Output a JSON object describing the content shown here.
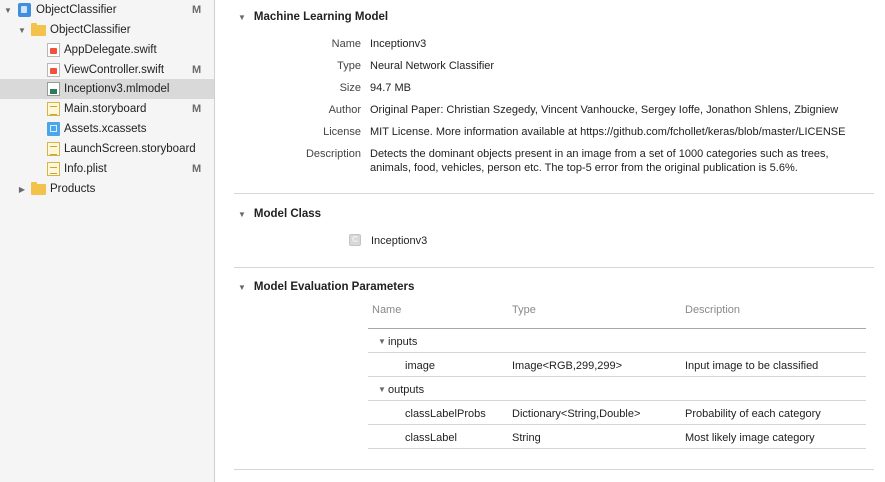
{
  "navigator": {
    "items": [
      {
        "label": "ObjectClassifier",
        "badge": "M",
        "icon": "project-icon",
        "disclosure": "open"
      },
      {
        "label": "ObjectClassifier",
        "badge": "",
        "icon": "folder-icon",
        "disclosure": "open"
      },
      {
        "label": "AppDelegate.swift",
        "badge": "",
        "icon": "swift-file-icon"
      },
      {
        "label": "ViewController.swift",
        "badge": "M",
        "icon": "swift-file-icon"
      },
      {
        "label": "Inceptionv3.mlmodel",
        "badge": "",
        "icon": "mlmodel-file-icon",
        "selected": true
      },
      {
        "label": "Main.storyboard",
        "badge": "M",
        "icon": "storyboard-file-icon"
      },
      {
        "label": "Assets.xcassets",
        "badge": "",
        "icon": "asset-catalog-icon"
      },
      {
        "label": "LaunchScreen.storyboard",
        "badge": "",
        "icon": "storyboard-file-icon"
      },
      {
        "label": "Info.plist",
        "badge": "M",
        "icon": "plist-file-icon"
      },
      {
        "label": "Products",
        "badge": "",
        "icon": "folder-icon",
        "disclosure": "closed"
      }
    ]
  },
  "model": {
    "section_title": "Machine Learning Model",
    "properties": [
      {
        "label": "Name",
        "value": "Inceptionv3"
      },
      {
        "label": "Type",
        "value": "Neural Network Classifier"
      },
      {
        "label": "Size",
        "value": "94.7 MB"
      },
      {
        "label": "Author",
        "value": "Original Paper: Christian Szegedy, Vincent Vanhoucke, Sergey Ioffe, Jonathon Shlens, Zbigniew"
      },
      {
        "label": "License",
        "value": "MIT License. More information available at https://github.com/fchollet/keras/blob/master/LICENSE"
      },
      {
        "label": "Description",
        "value": "Detects the dominant objects present in an image from a set of 1000 categories such as trees,",
        "value_line2": "animals, food, vehicles, person etc. The top-5 error from the original publication is 5.6%."
      }
    ]
  },
  "model_class": {
    "section_title": "Model Class",
    "class_name": "Inceptionv3",
    "icon_glyph": "C"
  },
  "evaluation": {
    "section_title": "Model Evaluation Parameters",
    "columns": [
      "Name",
      "Type",
      "Description"
    ],
    "groups": [
      {
        "name": "inputs",
        "rows": [
          {
            "name": "image",
            "type": "Image<RGB,299,299>",
            "description": "Input image to be classified"
          }
        ]
      },
      {
        "name": "outputs",
        "rows": [
          {
            "name": "classLabelProbs",
            "type": "Dictionary<String,Double>",
            "description": "Probability of each category"
          },
          {
            "name": "classLabel",
            "type": "String",
            "description": "Most likely image category"
          }
        ]
      }
    ]
  }
}
